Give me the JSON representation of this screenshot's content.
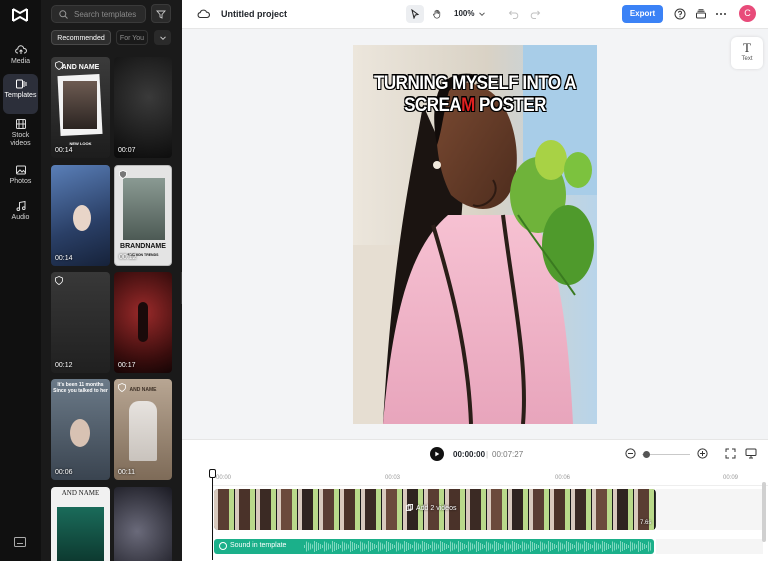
{
  "nav": {
    "items": [
      {
        "label": "Media",
        "icon": "cloud-upload-icon"
      },
      {
        "label": "Templates",
        "icon": "templates-icon",
        "active": true
      },
      {
        "label": "Stock videos",
        "icon": "film-icon"
      },
      {
        "label": "Photos",
        "icon": "image-icon"
      },
      {
        "label": "Audio",
        "icon": "music-note-icon"
      }
    ]
  },
  "templates": {
    "search_placeholder": "Search templates",
    "tabs": [
      "Recommended",
      "For You"
    ],
    "items": [
      {
        "duration": "00:14",
        "caption_top": "AND NAME",
        "caption_bottom": "NEW LOOK"
      },
      {
        "duration": "00:07"
      },
      {
        "duration": "00:14"
      },
      {
        "duration": "00:12",
        "caption_mid": "BRANDNAME",
        "caption_sub": "FASHION TRENDS"
      },
      {
        "duration": "00:12"
      },
      {
        "duration": "00:17"
      },
      {
        "duration": "00:06",
        "caption_top": "It's been 11 months Since you talked to her"
      },
      {
        "duration": "00:11",
        "caption_top": "AND NAME"
      },
      {
        "caption_top": "AND NAME"
      },
      {}
    ]
  },
  "topbar": {
    "project_title": "Untitled project",
    "zoom": "100%",
    "export_label": "Export",
    "avatar_initial": "C"
  },
  "canvas": {
    "overlay_line1": "TURNING MYSELF INTO A",
    "overlay_line2_pre": "SCREA",
    "overlay_line2_red": "M",
    "overlay_line2_post": " POSTER",
    "text_tool_label": "Text"
  },
  "timeline": {
    "current_time": "00:00:00",
    "separator": "|",
    "total_time": "00:07:27",
    "ruler": [
      "00:00",
      "00:03",
      "00:06",
      "00:09"
    ],
    "video_track_label": "Add 2 videos",
    "video_track_duration": "7.6s",
    "audio_track_label": "Sound in template"
  },
  "colors": {
    "accent": "#3b82f6",
    "audio_track": "#1bb08a",
    "avatar": "#e84b7a",
    "overlay_red": "#e02020"
  }
}
